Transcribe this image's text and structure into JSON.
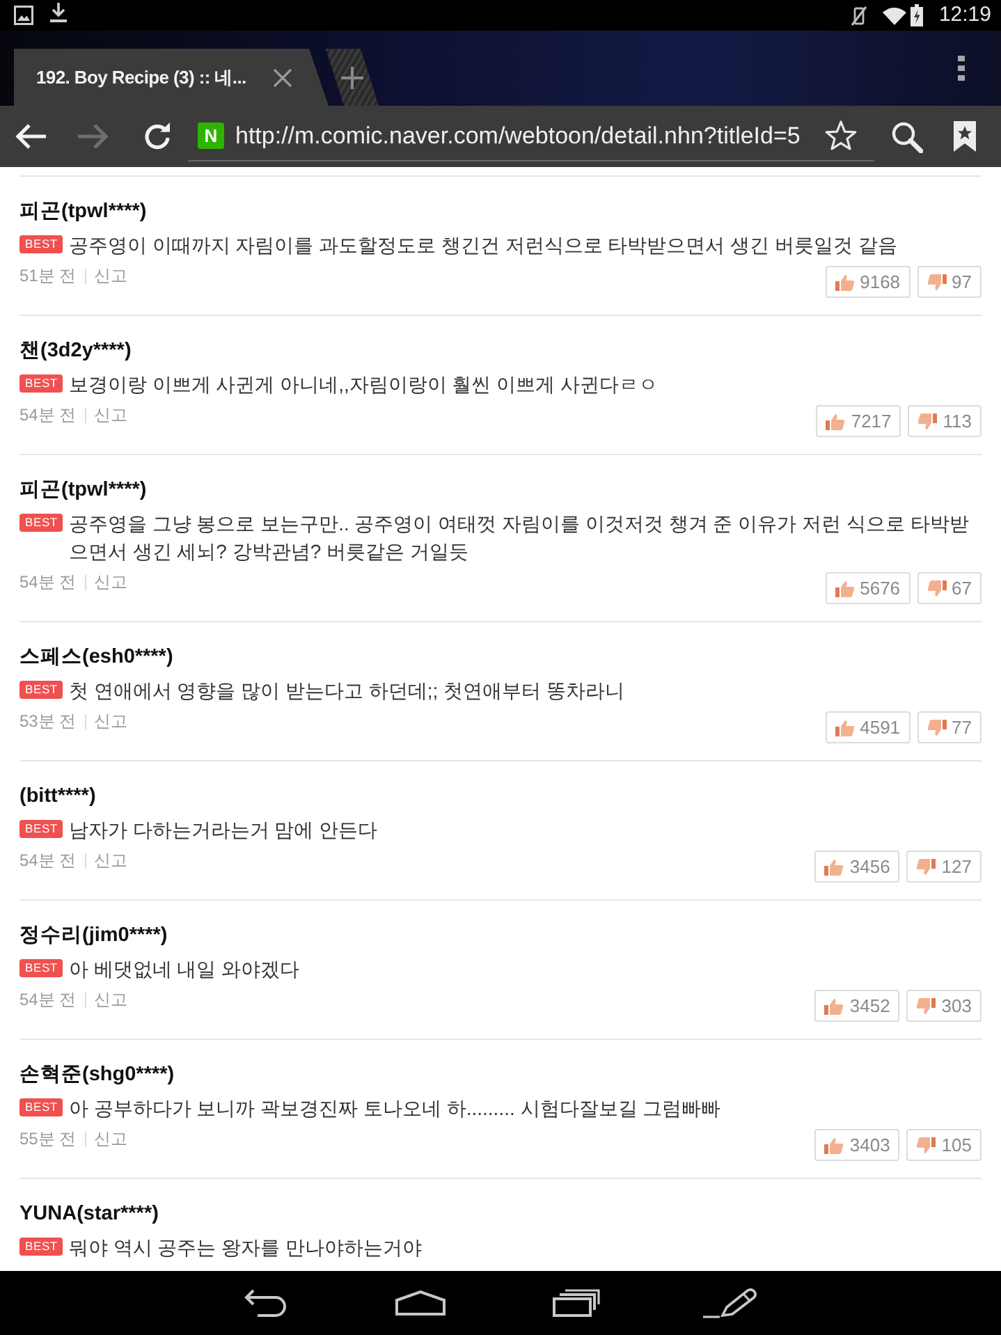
{
  "status_bar": {
    "time": "12:19"
  },
  "tabs": [
    {
      "title": "192. Boy Recipe (3) :: 네...",
      "selected": true
    }
  ],
  "nav_buttons": [
    {
      "kind": "back",
      "disabled": false
    },
    {
      "kind": "forward",
      "disabled": true
    },
    {
      "kind": "reload",
      "disabled": false
    }
  ],
  "address_bar": {
    "site_badge": "N",
    "url": "http://m.comic.naver.com/webtoon/detail.nhn?titleId=5"
  },
  "comments": [
    {
      "author": "피곤(tpwl****)",
      "badge": "BEST",
      "text": "공주영이 이때까지 자림이를 과도할정도로 챙긴건 저런식으로 타박받으면서 생긴 버릇일것 같음",
      "time": "51분 전",
      "report": "신고",
      "likes": "9168",
      "dislikes": "97"
    },
    {
      "author": "챈(3d2y****)",
      "badge": "BEST",
      "text": "보경이랑 이쁘게 사귄게 아니네,,자림이랑이 훨씬 이쁘게 사귄다ㄹㅇ",
      "time": "54분 전",
      "report": "신고",
      "likes": "7217",
      "dislikes": "113"
    },
    {
      "author": "피곤(tpwl****)",
      "badge": "BEST",
      "text": "공주영을 그냥 봉으로 보는구만.. 공주영이 여태껏 자림이를 이것저것 챙겨 준 이유가 저런 식으로 타박받으면서 생긴 세뇌? 강박관념? 버릇같은 거일듯",
      "time": "54분 전",
      "report": "신고",
      "likes": "5676",
      "dislikes": "67"
    },
    {
      "author": "스페스(esh0****)",
      "badge": "BEST",
      "text": "첫 연애에서 영향을 많이 받는다고 하던데;; 첫연애부터 똥차라니",
      "time": "53분 전",
      "report": "신고",
      "likes": "4591",
      "dislikes": "77"
    },
    {
      "author": "(bitt****)",
      "badge": "BEST",
      "text": "남자가 다하는거라는거 맘에 안든다",
      "time": "54분 전",
      "report": "신고",
      "likes": "3456",
      "dislikes": "127"
    },
    {
      "author": "정수리(jim0****)",
      "badge": "BEST",
      "text": "아 베댓없네 내일 와야겠다",
      "time": "54분 전",
      "report": "신고",
      "likes": "3452",
      "dislikes": "303"
    },
    {
      "author": "손혁준(shg0****)",
      "badge": "BEST",
      "text": "아 공부하다가 보니까 곽보경진짜 토나오네 하......... 시험다잘보길 그럼빠빠",
      "time": "55분 전",
      "report": "신고",
      "likes": "3403",
      "dislikes": "105"
    },
    {
      "author": "YUNA(star****)",
      "badge": "BEST",
      "text": "뭐야 역시 공주는 왕자를 만나야하는거야"
    }
  ]
}
